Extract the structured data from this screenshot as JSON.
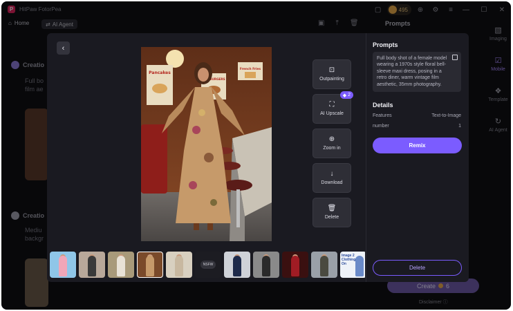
{
  "app": {
    "title": "HitPaw FotorPea",
    "credits": "495"
  },
  "nav": {
    "home": "Home",
    "agent": "AI Agent"
  },
  "background": {
    "card1_title": "Creatio",
    "card1_text_line1": "Full bo",
    "card1_text_line2": "film ae",
    "card2_title": "Creatio",
    "card2_text_line1": "Mediu",
    "card2_text_line2": "backgr",
    "right_header": "Prompts",
    "create_label": "Create",
    "create_cost": "6",
    "disclaimer": "Disclaimer"
  },
  "rail": [
    {
      "label": "Imaging",
      "icon": "image-icon"
    },
    {
      "label": "Mobile",
      "icon": "mobile-icon"
    },
    {
      "label": "Template",
      "icon": "template-icon"
    },
    {
      "label": "AI Agent",
      "icon": "agent-icon"
    }
  ],
  "modal": {
    "photo_signs": {
      "left": "Pancakes",
      "middle": "HAMBURGERS",
      "right": "French Fries"
    },
    "actions": [
      {
        "label": "Outpainting",
        "icon": "outpainting-icon"
      },
      {
        "label": "AI Upscale",
        "icon": "upscale-icon",
        "badge": "2"
      },
      {
        "label": "Zoom in",
        "icon": "zoom-in-icon"
      },
      {
        "label": "Download",
        "icon": "download-icon"
      },
      {
        "label": "Delete",
        "icon": "trash-icon"
      }
    ],
    "prompts_heading": "Prompts",
    "prompt_text": "Full body shot of a female model wearing a 1970s style floral bell-sleeve maxi dress, posing in a retro diner, warm vintage film aesthetic, 35mm photography.",
    "details_heading": "Details",
    "details": [
      {
        "key": "Features",
        "value": "Text-to-Image"
      },
      {
        "key": "number",
        "value": "1"
      }
    ],
    "remix_label": "Remix",
    "delete_label": "Delete",
    "thumbnail_nsfw_label": "NSFW",
    "thumbnail_text": "Image 2 Clothing On"
  },
  "colors": {
    "accent": "#7b5cff",
    "background": "#0f0f13",
    "modal": "#1a1a21",
    "logo": "#e0245e"
  }
}
